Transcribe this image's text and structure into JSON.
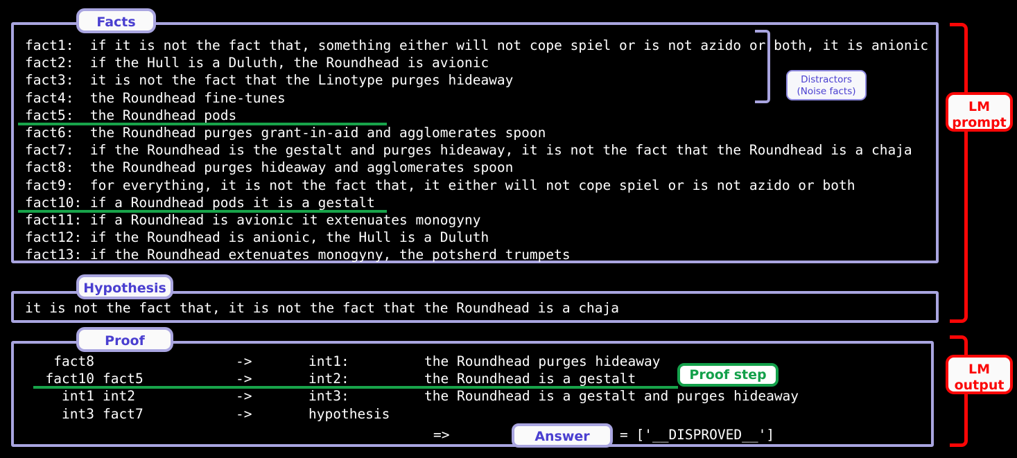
{
  "sections": {
    "facts": {
      "label": "Facts",
      "items": [
        "fact1:  if it is not the fact that, something either will not cope spiel or is not azido or both, it is anionic",
        "fact2:  if the Hull is a Duluth, the Roundhead is avionic",
        "fact3:  it is not the fact that the Linotype purges hideaway",
        "fact4:  the Roundhead fine-tunes",
        "fact5:  the Roundhead pods",
        "fact6:  the Roundhead purges grant-in-aid and agglomerates spoon",
        "fact7:  if the Roundhead is the gestalt and purges hideaway, it is not the fact that the Roundhead is a chaja",
        "fact8:  the Roundhead purges hideaway and agglomerates spoon",
        "fact9:  for everything, it is not the fact that, it either will not cope spiel or is not azido or both",
        "fact10: if a Roundhead pods it is a gestalt",
        "fact11: if a Roundhead is avionic it extenuates monogyny",
        "fact12: if the Roundhead is anionic, the Hull is a Duluth",
        "fact13: if the Roundhead extenuates monogyny, the potsherd trumpets"
      ],
      "highlighted_indices": [
        4,
        9
      ]
    },
    "hypothesis": {
      "label": "Hypothesis",
      "text": "it is not the fact that, it is not the fact that the Roundhead is a chaja"
    },
    "proof": {
      "label": "Proof",
      "rows": [
        {
          "premise1": "fact8",
          "premise2": "",
          "arrow": "->",
          "conclusion": "int1:",
          "text": "the Roundhead purges hideaway",
          "highlighted": false
        },
        {
          "premise1": "fact10",
          "premise2": "fact5",
          "arrow": "->",
          "conclusion": "int2:",
          "text": "the Roundhead is a gestalt",
          "highlighted": true
        },
        {
          "premise1": "int1",
          "premise2": "int2",
          "arrow": "->",
          "conclusion": "int3:",
          "text": "the Roundhead is a gestalt and purges hideaway",
          "highlighted": false
        },
        {
          "premise1": "int3",
          "premise2": "fact7",
          "arrow": "->",
          "conclusion": "hypothesis",
          "text": "",
          "highlighted": false
        }
      ],
      "answer_arrow": "=>",
      "answer_label": "Answer",
      "answer_value": "= ['__DISPROVED__']"
    }
  },
  "annotations": {
    "distractors": "Distractors\n(Noise facts)",
    "distractors_line1": "Distractors",
    "distractors_line2": "(Noise facts)",
    "proof_step": "Proof step",
    "lm_prompt_line1": "LM",
    "lm_prompt_line2": "prompt",
    "lm_output_line1": "LM",
    "lm_output_line2": "output"
  },
  "colors": {
    "background": "#000000",
    "panel_border": "#a9a5e0",
    "panel_label_text": "#4a3fd0",
    "text": "#ffffff",
    "highlight_green": "#18a34a",
    "proof_step_green": "#13a04a",
    "lm_red": "#fb0606"
  }
}
